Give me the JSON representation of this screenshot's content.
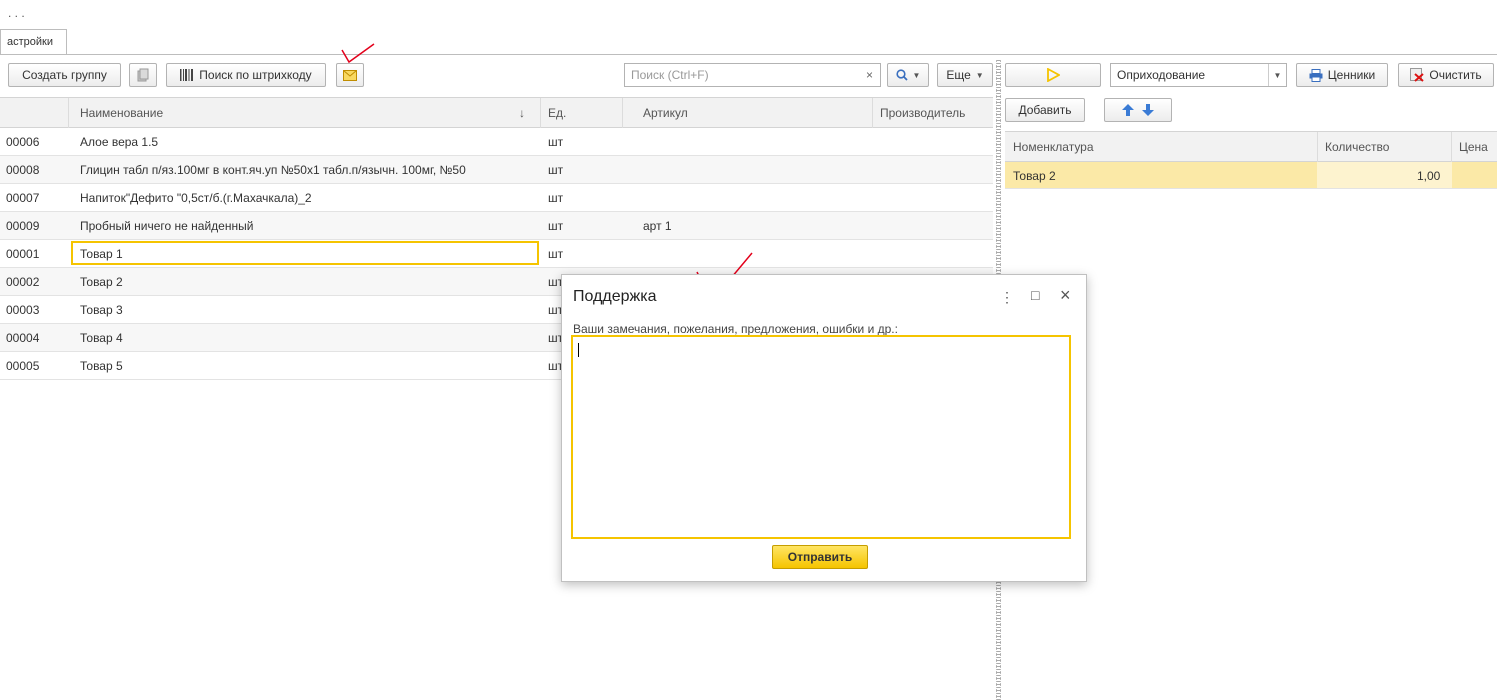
{
  "top_dots": ". .   .",
  "tab": {
    "label": "астройки"
  },
  "toolbar_left": {
    "create_group": "Создать группу",
    "barcode_search": "Поиск по штрихкоду",
    "search_placeholder": "Поиск (Ctrl+F)",
    "search_clear": "×",
    "more": "Еще"
  },
  "table": {
    "columns": [
      "Наименование",
      "Ед.",
      "Артикул",
      "Производитель"
    ],
    "sort_indicator": "↓",
    "rows": [
      {
        "code": "00006",
        "name": "Алое вера 1.5",
        "unit": "шт",
        "article": ""
      },
      {
        "code": "00008",
        "name": "Глицин табл п/яз.100мг в конт.яч.уп №50х1 табл.п/язычн. 100мг, №50",
        "unit": "шт",
        "article": ""
      },
      {
        "code": "00007",
        "name": "Напиток\"Дефито \"0,5ст/б.(г.Махачкала)_2",
        "unit": "шт",
        "article": ""
      },
      {
        "code": "00009",
        "name": "Пробный ничего не найденный",
        "unit": "шт",
        "article": "арт 1"
      },
      {
        "code": "00001",
        "name": "Товар 1",
        "unit": "шт",
        "article": ""
      },
      {
        "code": "00002",
        "name": "Товар 2",
        "unit": "шт",
        "article": ""
      },
      {
        "code": "00003",
        "name": "Товар 3",
        "unit": "шт",
        "article": ""
      },
      {
        "code": "00004",
        "name": "Товар 4",
        "unit": "шт",
        "article": ""
      },
      {
        "code": "00005",
        "name": "Товар 5",
        "unit": "шт",
        "article": ""
      }
    ]
  },
  "toolbar_right": {
    "operation": "Оприходование",
    "price_tags": "Ценники",
    "clear": "Очистить",
    "add": "Добавить"
  },
  "doc_table": {
    "columns": [
      "Номенклатура",
      "Количество",
      "Цена"
    ],
    "rows": [
      {
        "item": "Товар 2",
        "qty": "1,00"
      }
    ]
  },
  "dialog": {
    "title": "Поддержка",
    "more_icon": "⋮",
    "maximize_icon": "□",
    "close_icon": "×",
    "label": "Ваши замечания, пожелания, предложения, ошибки и др.:",
    "text_value": "",
    "send": "Отправить"
  },
  "colors": {
    "accent_yellow": "#f5c400",
    "selected_row": "#fbe9a7",
    "annotation_red": "#e3001b"
  }
}
